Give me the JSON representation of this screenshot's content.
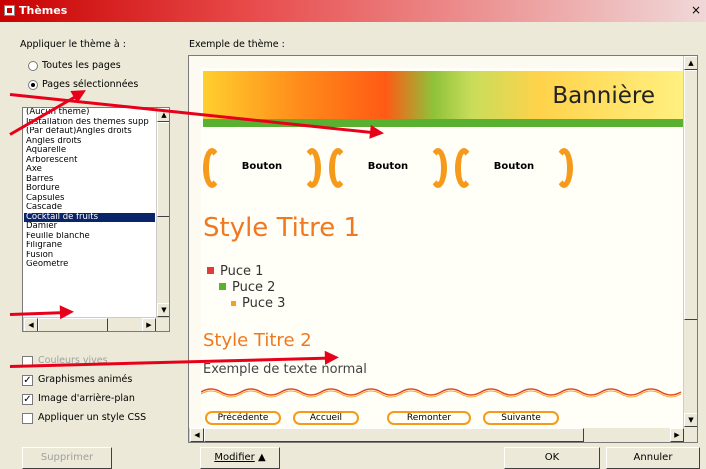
{
  "window": {
    "title": "Thèmes",
    "close_glyph": "×"
  },
  "left": {
    "apply_label": "Appliquer le thème à :",
    "radio_all": "Toutes les pages",
    "radio_selected": "Pages sélectionnées",
    "themes": [
      "(Aucun thème)",
      "Installation des thèmes supp",
      "(Par défaut)Angles droits",
      "Angles droits",
      "Aquarelle",
      "Arborescent",
      "Axe",
      "Barres",
      "Bordure",
      "Capsules",
      "Cascade",
      "Cocktail de fruits",
      "Damier",
      "Feuille blanche",
      "Filigrane",
      "Fusion",
      "Géomètre"
    ],
    "selected_theme": "Cocktail de fruits",
    "options": [
      {
        "label": "Couleurs vives",
        "checked": false
      },
      {
        "label": "Graphismes animés",
        "checked": true
      },
      {
        "label": "Image d'arrière-plan",
        "checked": true
      },
      {
        "label": "Appliquer un style CSS",
        "checked": false
      }
    ],
    "delete_button": "Supprimer"
  },
  "preview": {
    "label": "Exemple de thème :",
    "banner": "Bannière",
    "nav_buttons": [
      "Bouton",
      "Bouton",
      "Bouton"
    ],
    "heading1": "Style Titre 1",
    "bullets": [
      "Puce 1",
      "Puce 2",
      "Puce 3"
    ],
    "heading2": "Style Titre 2",
    "normal_text": "Exemple de texte normal",
    "nav_small": [
      "Précédente",
      "Accueil",
      "Remonter",
      "Suivante"
    ]
  },
  "buttons": {
    "modify": "Modifier",
    "modify_arrow": "▲",
    "ok": "OK",
    "cancel": "Annuler"
  },
  "colors": {
    "accent": "#f07820",
    "banner_green": "#5ab030",
    "arrow_red": "#e8001a",
    "title_red": "#c80000"
  }
}
